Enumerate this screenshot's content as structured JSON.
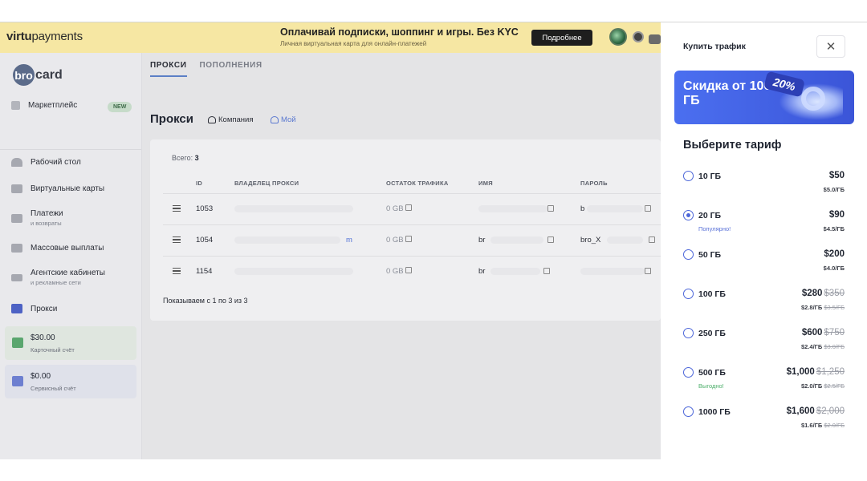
{
  "banner": {
    "logo_bold": "virtu",
    "logo_rest": "payments",
    "title": "Оплачивай подписки, шоппинг и игры. Без KYC",
    "subtitle": "Личная виртуальная карта для онлайн-платежей",
    "button": "Подробнее"
  },
  "brand": {
    "circle": "bro",
    "text": "card"
  },
  "sidebar": {
    "items": [
      {
        "label": "Маркетплейс",
        "badge": "NEW"
      },
      {
        "label": "Рабочий стол"
      },
      {
        "label": "Виртуальные карты"
      },
      {
        "label": "Платежи",
        "sub": "и возвраты"
      },
      {
        "label": "Массовые выплаты"
      },
      {
        "label": "Агентские кабинеты",
        "sub": "и рекламные сети"
      },
      {
        "label": "Прокси"
      }
    ],
    "wallets": [
      {
        "amount": "$30.00",
        "label": "Карточный счёт",
        "color": "#5aa66e"
      },
      {
        "amount": "$0.00",
        "label": "Сервисный счёт",
        "color": "#6d7fd0"
      }
    ]
  },
  "main": {
    "tabs": [
      "ПРОКСИ",
      "ПОПОЛНЕНИЯ"
    ],
    "title": "Прокси",
    "filters": [
      "Компания",
      "Мой"
    ],
    "total_label": "Всего:",
    "total_value": "3",
    "columns": [
      "ID",
      "ВЛАДЕЛЕЦ ПРОКСИ",
      "ОСТАТОК ТРАФИКА",
      "ИМЯ",
      "ПАРОЛЬ"
    ],
    "rows": [
      {
        "id": "1053",
        "owner_tail": "",
        "traffic": "0 GB",
        "name": "",
        "password": "b"
      },
      {
        "id": "1054",
        "owner_tail": "m",
        "traffic": "0 GB",
        "name": "br",
        "password": "bro_X"
      },
      {
        "id": "1154",
        "owner_tail": "",
        "traffic": "0 GB",
        "name": "br",
        "password": ""
      }
    ],
    "showing": "Показываем с 1 по 3 из 3"
  },
  "drawer": {
    "title": "Купить трафик",
    "close": "✕",
    "promo_text": "Скидка от 100 ГБ",
    "promo_tag": "20%",
    "choose": "Выберите тариф",
    "accent": "#4c66d9",
    "plans": [
      {
        "name": "10 ГБ",
        "price": "$50",
        "old": "",
        "per": "$5.0/ГБ",
        "per_old": "",
        "note": "",
        "selected": false
      },
      {
        "name": "20 ГБ",
        "price": "$90",
        "old": "",
        "per": "$4.5/ГБ",
        "per_old": "",
        "note": "Популярно!",
        "note_color": "#5a72d8",
        "selected": true
      },
      {
        "name": "50 ГБ",
        "price": "$200",
        "old": "",
        "per": "$4.0/ГБ",
        "per_old": "",
        "note": "",
        "selected": false
      },
      {
        "name": "100 ГБ",
        "price": "$280",
        "old": "$350",
        "per": "$2.8/ГБ",
        "per_old": "$3.5/ГБ",
        "note": "",
        "selected": false
      },
      {
        "name": "250 ГБ",
        "price": "$600",
        "old": "$750",
        "per": "$2.4/ГБ",
        "per_old": "$3.0/ГБ",
        "note": "",
        "selected": false
      },
      {
        "name": "500 ГБ",
        "price": "$1,000",
        "old": "$1,250",
        "per": "$2.0/ГБ",
        "per_old": "$2.5/ГБ",
        "note": "Выгодно!",
        "note_color": "#4caf6a",
        "selected": false
      },
      {
        "name": "1000 ГБ",
        "price": "$1,600",
        "old": "$2,000",
        "per": "$1.6/ГБ",
        "per_old": "$2.0/ГБ",
        "note": "",
        "selected": false
      }
    ]
  }
}
